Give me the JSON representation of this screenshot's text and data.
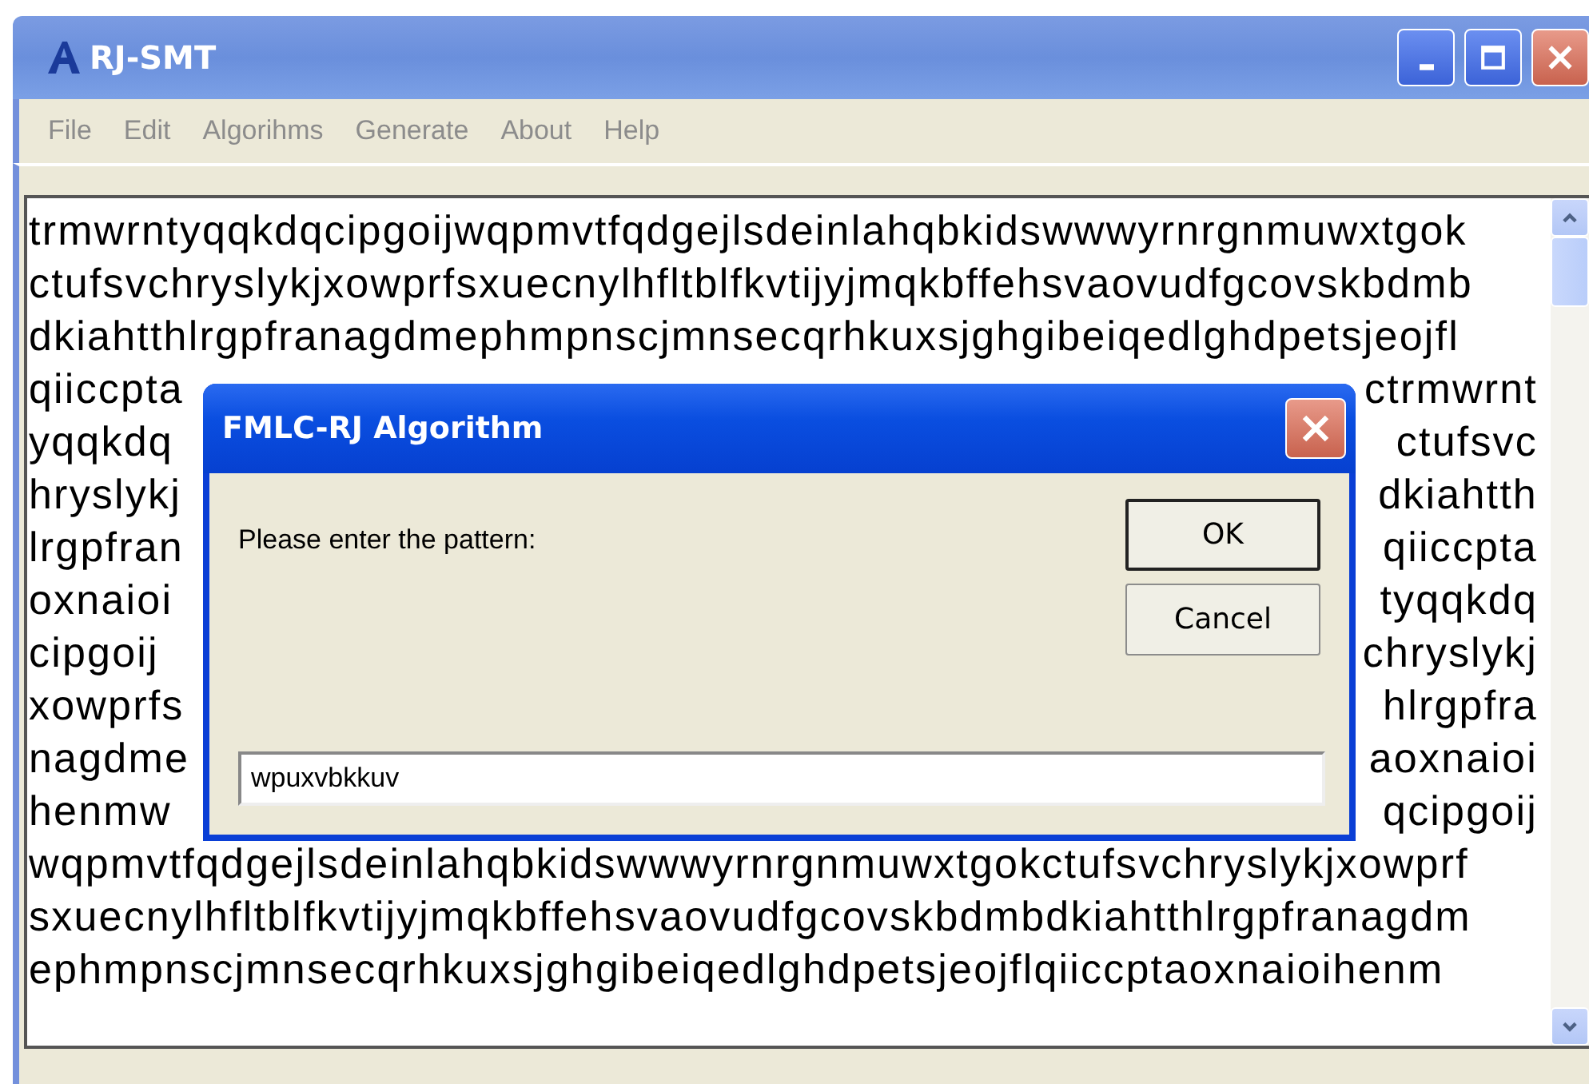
{
  "window": {
    "title": "RJ-SMT"
  },
  "menu": [
    "File",
    "Edit",
    "Algorihms",
    "Generate",
    "About",
    "Help"
  ],
  "text_area": {
    "lines": [
      {
        "kind": "full",
        "text": "trmwrntyqqkdqcipgoijwqpmvtfqdgejlsdeinlahqbkidswwwyrnrgnmuwxtgok"
      },
      {
        "kind": "full",
        "text": "ctufsvchryslykjxowprfsxuecnylhfltblfkvtijyjmqkbffehsvaovudfgcovskbdmb"
      },
      {
        "kind": "full",
        "text": "dkiahtthlrgpfranagdmephmpnscjmnsecqrhkuxsjghgibeiqedlghdpetsjeojfl"
      },
      {
        "kind": "split",
        "left": "qiiccpta",
        "right": "ctrmwrnt"
      },
      {
        "kind": "split",
        "left": "yqqkdq",
        "right": "ctufsvc"
      },
      {
        "kind": "split",
        "left": "hryslykj",
        "right": "dkiahtth"
      },
      {
        "kind": "split",
        "left": "lrgpfran",
        "right": "qiiccpta"
      },
      {
        "kind": "split",
        "left": "oxnaioi",
        "right": "tyqqkdq"
      },
      {
        "kind": "split",
        "left": "cipgoij",
        "right": "chryslykj"
      },
      {
        "kind": "split",
        "left": "xowprfs",
        "right": "hlrgpfra"
      },
      {
        "kind": "split",
        "left": "nagdme",
        "right": "aoxnaioi"
      },
      {
        "kind": "split",
        "left": "henmw",
        "right": "qcipgoij"
      },
      {
        "kind": "full",
        "text": "wqpmvtfqdgejlsdeinlahqbkidswwwyrnrgnmuwxtgokctufsvchryslykjxowprf"
      },
      {
        "kind": "full",
        "text": "sxuecnylhfltblfkvtijyjmqkbffehsvaovudfgcovskbdmbdkiahtthlrgpfranagdm"
      },
      {
        "kind": "full",
        "text": "ephmpnscjmnsecqrhkuxsjghgibeiqedlghdpetsjeojflqiiccptaoxnaioihenm"
      }
    ]
  },
  "dialog": {
    "title": "FMLC-RJ Algorithm",
    "prompt": "Please enter the pattern:",
    "buttons": [
      "OK",
      "Cancel"
    ],
    "input": {
      "value": "wpuxvbkkuv"
    }
  }
}
